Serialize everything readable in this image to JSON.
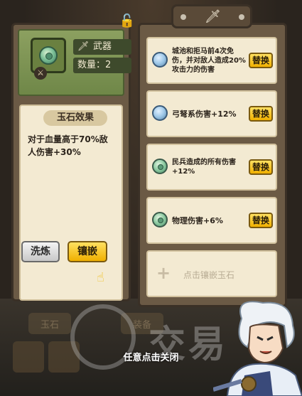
{
  "left": {
    "type_label": "武器",
    "count_label": "数量：2",
    "effect_title": "玉石效果",
    "effect_text": "对于血量高于70%敌人伤害+30%",
    "wash_button": "洗炼",
    "inlay_button": "镶嵌"
  },
  "slots": [
    {
      "text": "城池和拒马前4次免伤，并对敌人造成20%攻击力的伤害",
      "gem": "blue",
      "button": "替换"
    },
    {
      "text": "弓弩系伤害+12%",
      "gem": "blue",
      "button": "替换"
    },
    {
      "text": "民兵造成的所有伤害+12%",
      "gem": "green",
      "button": "替换"
    },
    {
      "text": "物理伤害+6%",
      "gem": "green",
      "button": "替换"
    }
  ],
  "empty_slot": {
    "hint": "点击镶嵌玉石"
  },
  "close_hint": "任意点击关闭",
  "background_tabs": [
    "玉石",
    "装备"
  ],
  "watermark": "交易",
  "colors": {
    "panel": "#6b5a45",
    "parchment": "#f3ead2",
    "button_yellow": "#f0b000",
    "gem_green": "#7fc29a",
    "gem_blue": "#9ec8e8"
  }
}
